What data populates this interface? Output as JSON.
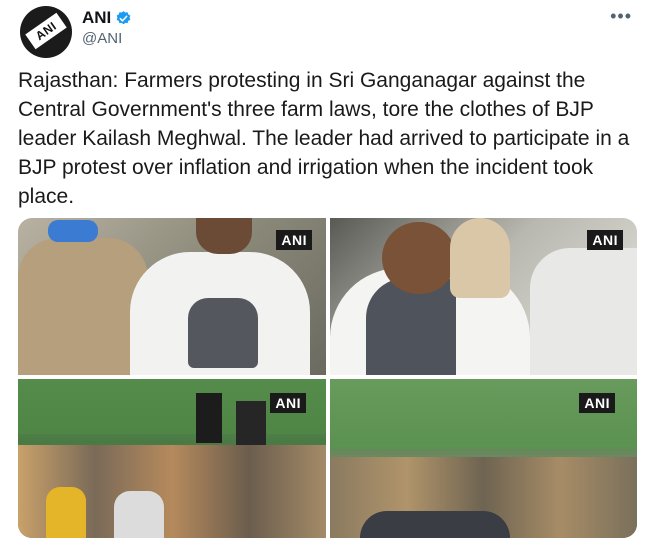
{
  "account": {
    "name": "ANI",
    "handle": "@ANI",
    "avatar_text": "ANI",
    "verified": true,
    "verified_color": "#1d9bf0"
  },
  "menu": {
    "more_label": "•••",
    "icon": "more-horizontal-icon"
  },
  "tweet": {
    "text": "Rajasthan: Farmers protesting in Sri Ganganagar against the Central Government's three farm laws, tore the clothes of BJP leader Kailash Meghwal. The leader had arrived to participate in a BJP protest over inflation and irrigation when the incident took place."
  },
  "media": {
    "watermarks": [
      "ANI",
      "ANI",
      "ANI",
      "ANI"
    ]
  }
}
